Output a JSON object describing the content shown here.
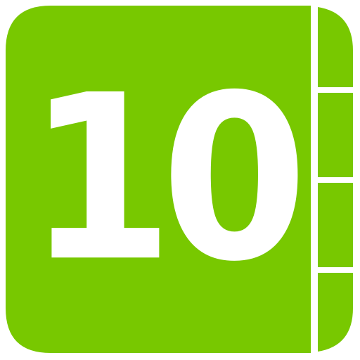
{
  "app_icon": {
    "label": "10",
    "icon_name": "notebook-icon",
    "colors": {
      "accent": "#78C800",
      "background": "#FFFFFF",
      "text": "#FFFFFF"
    }
  }
}
